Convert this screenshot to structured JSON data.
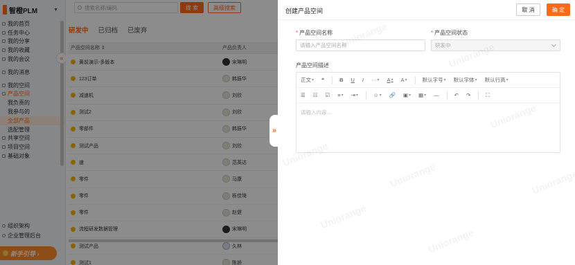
{
  "app": {
    "brand": "智橙PLM"
  },
  "sidebar": {
    "items": [
      {
        "label": "我的首页"
      },
      {
        "label": "任务中心"
      },
      {
        "label": "我的分享"
      },
      {
        "label": "我的收藏"
      },
      {
        "label": "我的会议"
      },
      {
        "label": "我的消息"
      },
      {
        "label": "我的空间"
      },
      {
        "label": "产品空间"
      },
      {
        "label": "我负责的"
      },
      {
        "label": "我参与的"
      },
      {
        "label": "全部产品"
      },
      {
        "label": "选配管理"
      },
      {
        "label": "共享空间"
      },
      {
        "label": "项目空间"
      },
      {
        "label": "基础对象"
      }
    ],
    "bottom": [
      {
        "label": "组织架构"
      },
      {
        "label": "企业管理后台"
      }
    ],
    "guide_label": "新手引导 ›"
  },
  "main": {
    "search_placeholder": "搜索名称/编码",
    "search_btn": "搜 索",
    "adv_btn": "高级搜索",
    "tabs": [
      "研发中",
      "已归档",
      "已废弃"
    ],
    "columns": [
      "产品空间名称 ⇕",
      "产品负责人"
    ],
    "rows": [
      {
        "name": "黄前演示-多版本",
        "owner": "宋琳明"
      },
      {
        "name": "123订单",
        "owner": "韩振华"
      },
      {
        "name": "减速机",
        "owner": "刘欣"
      },
      {
        "name": "测试2",
        "owner": "刘欣"
      },
      {
        "name": "零部件",
        "owner": "韩振华"
      },
      {
        "name": "测试产品",
        "owner": "刘欣"
      },
      {
        "name": "速",
        "owner": "范英达"
      },
      {
        "name": "零件",
        "owner": "马康"
      },
      {
        "name": "零件",
        "owner": "栎佳琦"
      },
      {
        "name": "零件",
        "owner": "赵健"
      },
      {
        "name": "流程研发数据管理",
        "owner": "宋琳明"
      },
      {
        "name": "测试产品",
        "owner": "久林"
      },
      {
        "name": "测试1",
        "owner": "陈娇"
      }
    ]
  },
  "drawer": {
    "title": "创建产品空间",
    "cancel": "取 消",
    "ok": "确 定",
    "name_label": "产品空间名称",
    "name_placeholder": "请输入产品空间名称",
    "status_label": "产品空间状态",
    "status_value": "研发中",
    "desc_label": "产品空间描述",
    "editor": {
      "row1": [
        "正文",
        "❝",
        "B",
        "U",
        "I",
        "···",
        "A",
        "A",
        "默认字号",
        "默认字体",
        "默认行高"
      ],
      "row2": [
        "☰",
        "☷",
        "☑",
        "≡",
        "⇥",
        "☺",
        "🔗",
        "▣",
        "▦",
        "—",
        "↶",
        "↷",
        "⛶"
      ],
      "placeholder": "请输入内容..."
    }
  },
  "watermark": "Uniorange"
}
